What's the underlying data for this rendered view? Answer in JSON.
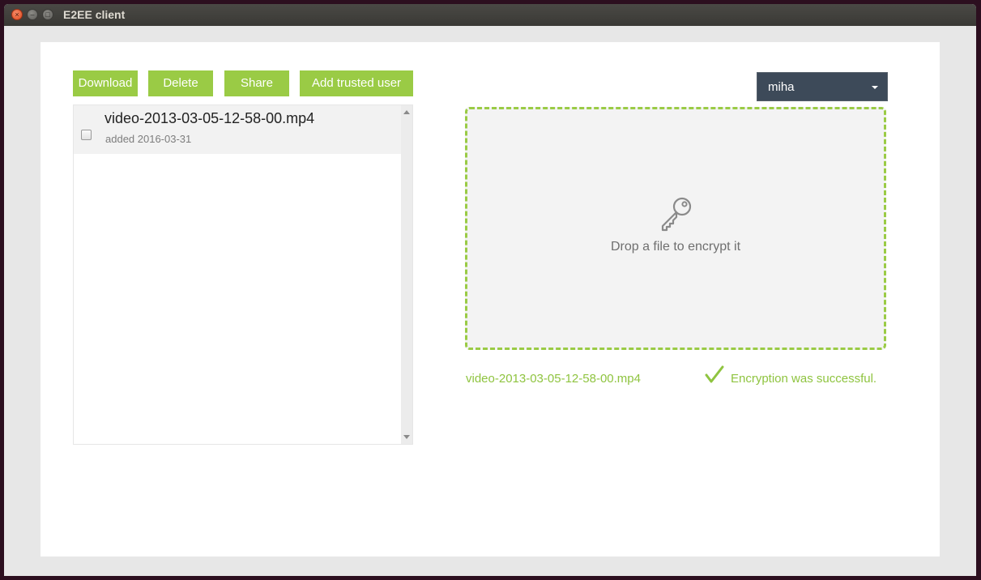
{
  "window": {
    "title": "E2EE client",
    "close_glyph": "×",
    "minimize_glyph": "–",
    "maximize_glyph": "□"
  },
  "toolbar": {
    "download_label": "Download",
    "delete_label": "Delete",
    "share_label": "Share",
    "add_trusted_user_label": "Add trusted user"
  },
  "files": [
    {
      "name": "video-2013-03-05-12-58-00.mp4",
      "added": "added 2016-03-31",
      "checked": false
    }
  ],
  "user_select": {
    "selected": "miha"
  },
  "dropzone": {
    "text": "Drop a file to encrypt it",
    "icon": "key-icon"
  },
  "status": {
    "file_name": "video-2013-03-05-12-58-00.mp4",
    "message": "Encryption was successful.",
    "icon": "checkmark-icon"
  },
  "colors": {
    "accent": "#9acb45",
    "status_text": "#8fc440",
    "select_bg": "#3d4a59"
  }
}
